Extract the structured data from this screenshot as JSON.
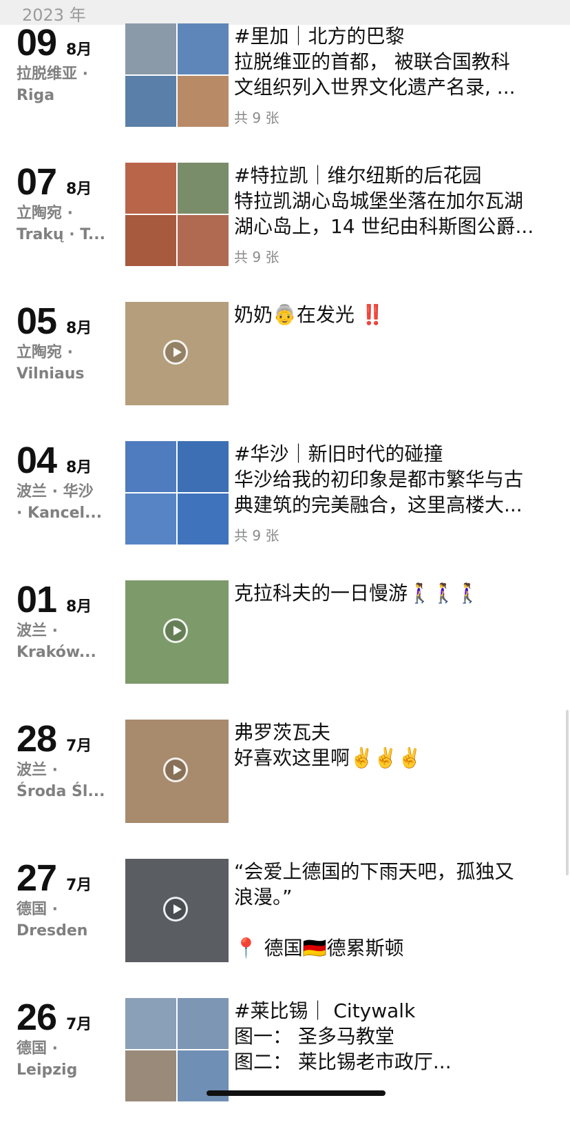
{
  "year_header": "2023 年",
  "entries": [
    {
      "day": "09",
      "month": "8月",
      "loc1": "拉脱维亚 ·",
      "loc2": "Riga",
      "lines": [
        "#里加｜北方的巴黎",
        "拉脱维亚的首都， 被联合国教科",
        "文组织列入世界文化遗产名录, ..."
      ],
      "count": "共 9 张",
      "media": "grid",
      "colors": [
        "#8a9aa8",
        "#5f86b8",
        "#5a7fa8",
        "#b88a66"
      ]
    },
    {
      "day": "07",
      "month": "8月",
      "loc1": "立陶宛 ·",
      "loc2": "Trakų · T...",
      "lines": [
        "#特拉凯｜维尔纽斯的后花园",
        "特拉凯湖心岛城堡坐落在加尔瓦湖",
        "湖心岛上，14 世纪由科斯图公爵..."
      ],
      "count": "共 9 张",
      "media": "grid",
      "colors": [
        "#b8654a",
        "#7a8d6a",
        "#a85a3e",
        "#b06a52"
      ]
    },
    {
      "day": "05",
      "month": "8月",
      "loc1": "立陶宛 ·",
      "loc2": "Vilniaus",
      "lines": [
        "奶奶👵在发光 ‼️"
      ],
      "count": "",
      "media": "video",
      "colors": [
        "#b59e7c"
      ]
    },
    {
      "day": "04",
      "month": "8月",
      "loc1": "波兰 · 华沙",
      "loc2": "· Kancel...",
      "lines": [
        "#华沙｜新旧时代的碰撞",
        "华沙给我的初印象是都市繁华与古",
        "典建筑的完美融合，这里高楼大..."
      ],
      "count": "共 9 张",
      "media": "grid",
      "colors": [
        "#4f7cbf",
        "#3d6fb4",
        "#5684c4",
        "#3f74bd"
      ]
    },
    {
      "day": "01",
      "month": "8月",
      "loc1": "波兰 ·",
      "loc2": "Kraków...",
      "lines": [
        "克拉科夫的一日慢游🚶‍♀️🚶‍♀️🚶‍♀️"
      ],
      "count": "",
      "media": "video",
      "colors": [
        "#7d9a6a"
      ]
    },
    {
      "day": "28",
      "month": "7月",
      "loc1": "波兰 ·",
      "loc2": "Środa Śl...",
      "lines": [
        "弗罗茨瓦夫",
        "好喜欢这里啊✌️✌️✌️"
      ],
      "count": "",
      "media": "video",
      "colors": [
        "#a88a6c"
      ]
    },
    {
      "day": "27",
      "month": "7月",
      "loc1": "德国 ·",
      "loc2": "Dresden",
      "lines": [
        "“会爱上德国的下雨天吧，孤独又",
        "浪漫。”",
        "",
        "📍 德国🇩🇪德累斯顿"
      ],
      "count": "",
      "media": "video",
      "colors": [
        "#5a5e63"
      ]
    },
    {
      "day": "26",
      "month": "7月",
      "loc1": "德国 ·",
      "loc2": "Leipzig",
      "lines": [
        "#莱比锡｜ Citywalk",
        "图一： 圣多马教堂",
        "图二： 莱比锡老市政厅..."
      ],
      "count": "",
      "media": "grid",
      "colors": [
        "#8aa0b8",
        "#7c96b4",
        "#9a8a7a",
        "#6f8fb5"
      ]
    }
  ]
}
